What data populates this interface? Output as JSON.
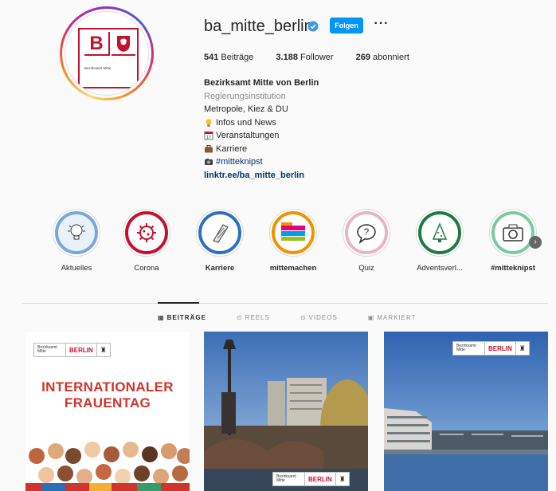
{
  "profile": {
    "username": "ba_mitte_berlin",
    "follow_label": "Folgen",
    "more_label": "···",
    "avatar_logo": {
      "letter": "B",
      "text": "Bezirksamt Mitte"
    },
    "stats": [
      {
        "count": "541",
        "label": "Beiträge"
      },
      {
        "count": "3.188",
        "label": "Follower"
      },
      {
        "count": "269",
        "label": "abonniert"
      }
    ],
    "bio": {
      "name": "Bezirksamt Mitte von Berlin",
      "category": "Regierungsinstitution",
      "line1": "Metropole, Kiez & DU",
      "line2": "Infos und News",
      "line3": "Veranstaltungen",
      "line4": "Karriere",
      "line5": "#mitteknipst",
      "link": "linktr.ee/ba_mitte_berlin"
    }
  },
  "highlights": [
    {
      "label": "Aktuelles",
      "icon": "lightbulb-icon",
      "color": "#4a7fc1"
    },
    {
      "label": "Corona",
      "icon": "virus-icon",
      "color": "#c8102e"
    },
    {
      "label": "Karriere",
      "icon": "paper-roll-icon",
      "color": "#2e6fc0"
    },
    {
      "label": "mittemachen",
      "icon": "mittemachen-logo",
      "color": "#f39200"
    },
    {
      "label": "Quiz",
      "icon": "question-bubble-icon",
      "color": "#e9a6c0"
    },
    {
      "label": "Adventsverl...",
      "icon": "christmas-tree-icon",
      "color": "#1f7a45"
    },
    {
      "label": "#mitteknipst",
      "icon": "camera-icon",
      "color": "#5cb88a"
    }
  ],
  "tabs": [
    {
      "label": "BEITRÄGE",
      "icon": "grid-icon",
      "active": true
    },
    {
      "label": "REELS",
      "icon": "reels-icon",
      "active": false
    },
    {
      "label": "VIDEOS",
      "icon": "play-icon",
      "active": false
    },
    {
      "label": "MARKIERT",
      "icon": "tag-icon",
      "active": false
    }
  ],
  "posts": [
    {
      "logo_small": "Bezirksamt Mitte",
      "logo_berlin": "BERLIN",
      "title_line1": "INTERNATIONALER",
      "title_line2": "FRAUENTAG"
    },
    {
      "logo_small": "Bezirksamt Mitte",
      "logo_berlin": "BERLIN"
    },
    {
      "logo_small": "Bezirksamt Mitte",
      "logo_berlin": "BERLIN"
    }
  ],
  "colors": {
    "accent": "#0095f6",
    "berlin_red": "#c8102e",
    "link": "#00376b"
  }
}
